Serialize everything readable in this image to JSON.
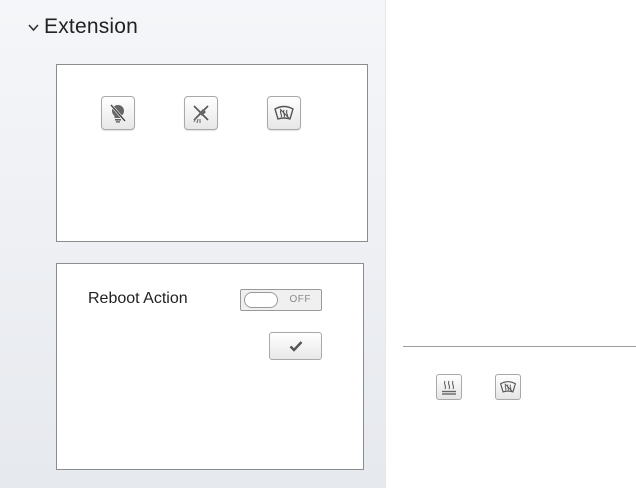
{
  "panel": {
    "section_title": "Extension",
    "icons": [
      {
        "name": "light-off-icon"
      },
      {
        "name": "wiper-off-icon"
      },
      {
        "name": "defrost-icon"
      }
    ],
    "reboot": {
      "label": "Reboot Action",
      "toggle_state": "OFF",
      "confirm_icon": "checkmark-icon"
    }
  },
  "right_panel": {
    "icons": [
      {
        "name": "seat-heat-icon"
      },
      {
        "name": "defrost-icon"
      }
    ]
  },
  "colors": {
    "panel_bg": "#eceef2",
    "border": "#8d8d8d",
    "text": "#222222"
  }
}
